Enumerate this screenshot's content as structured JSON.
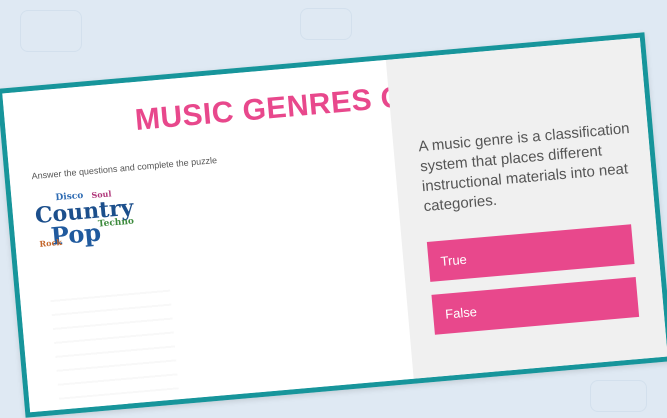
{
  "quiz": {
    "title": "MUSIC GENRES QUIZZ",
    "instructions": "Answer the questions and complete the puzzle",
    "question": "A music genre is a classification system that places different instructional materials into neat categories.",
    "answers": [
      {
        "label": "True"
      },
      {
        "label": "False"
      }
    ]
  },
  "word_cloud": {
    "words": [
      "Disco",
      "Soul",
      "Country",
      "Pop",
      "Techno",
      "Rock"
    ]
  },
  "colors": {
    "accent": "#e8488c",
    "frame": "#17959b",
    "background": "#dfe9f3",
    "right_panel": "#f0f0f0"
  }
}
